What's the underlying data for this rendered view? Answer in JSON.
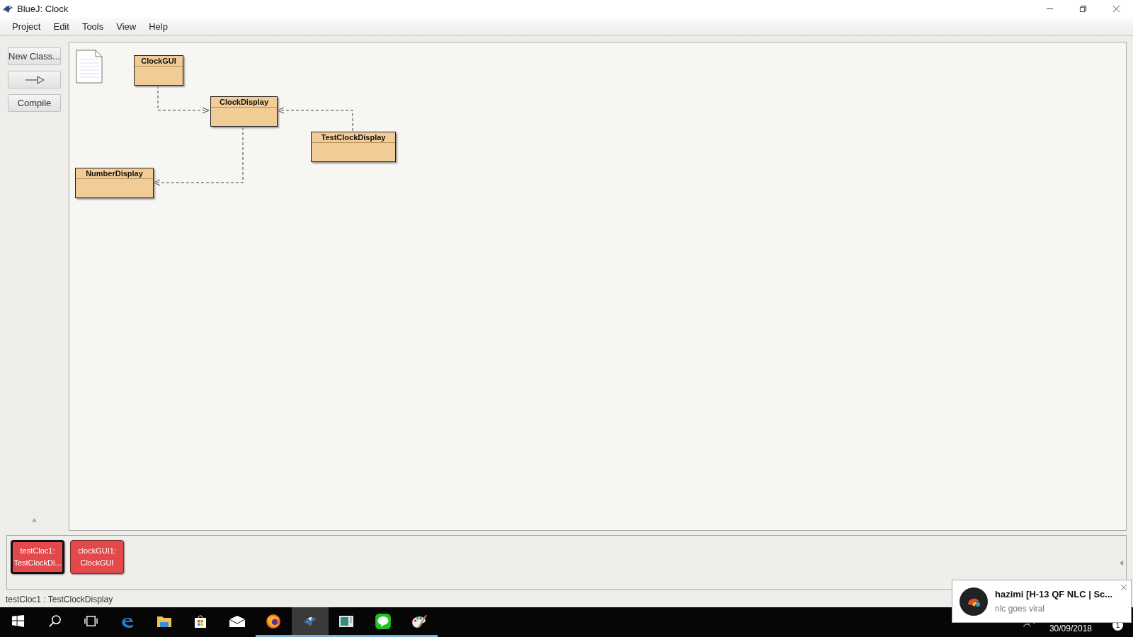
{
  "window": {
    "title": "BlueJ:  Clock"
  },
  "menu": [
    "Project",
    "Edit",
    "Tools",
    "View",
    "Help"
  ],
  "toolbar": [
    "New Class...",
    "Compile"
  ],
  "classes": [
    {
      "name": "ClockGUI"
    },
    {
      "name": "ClockDisplay"
    },
    {
      "name": "TestClockDisplay"
    },
    {
      "name": "NumberDisplay"
    }
  ],
  "objects": [
    {
      "label": "testCloc1:\nTestClockDi...",
      "selected": true
    },
    {
      "label": "clockGUI1:\nClockGUI",
      "selected": false
    }
  ],
  "status_bar": "testCloc1 : TestClockDisplay",
  "taskbar": {
    "apps": [
      {
        "kind": "start",
        "running": false,
        "selected": false
      },
      {
        "kind": "search",
        "running": false,
        "selected": false
      },
      {
        "kind": "taskview",
        "running": false,
        "selected": false
      },
      {
        "kind": "edge",
        "running": false,
        "selected": false
      },
      {
        "kind": "folder",
        "running": false,
        "selected": false
      },
      {
        "kind": "store",
        "running": false,
        "selected": false
      },
      {
        "kind": "mail",
        "running": false,
        "selected": false
      },
      {
        "kind": "firefox",
        "running": true,
        "selected": false
      },
      {
        "kind": "bird",
        "running": true,
        "selected": true
      },
      {
        "kind": "reader",
        "running": true,
        "selected": false
      },
      {
        "kind": "chat",
        "running": true,
        "selected": false
      },
      {
        "kind": "palette",
        "running": true,
        "selected": false
      }
    ],
    "date": "30/09/2018",
    "badge": "1"
  },
  "notification": {
    "title": "hazimi [H-13 QF NLC | Sc...",
    "body": "nlc goes viral"
  }
}
